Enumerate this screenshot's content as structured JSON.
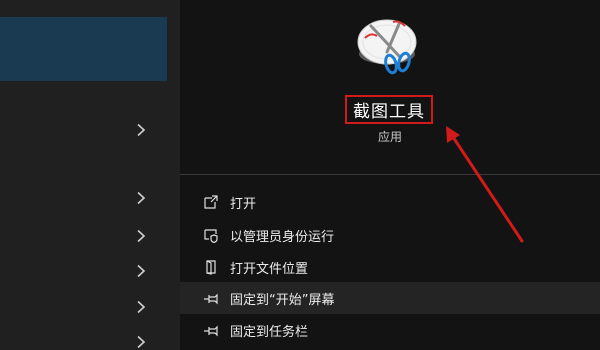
{
  "app": {
    "title": "截图工具",
    "subtitle": "应用",
    "icon": "snipping-tool-icon"
  },
  "left_panel": {
    "selected_color": "#1a3a52",
    "chevron_icon": "chevron-right-icon"
  },
  "context_menu": {
    "items": [
      {
        "label": "打开",
        "icon": "open-icon"
      },
      {
        "label": "以管理员身份运行",
        "icon": "run-as-admin-icon"
      },
      {
        "label": "打开文件位置",
        "icon": "file-location-icon"
      },
      {
        "label": "固定到“开始”屏幕",
        "icon": "pin-icon"
      },
      {
        "label": "固定到任务栏",
        "icon": "pin-icon"
      }
    ]
  },
  "colors": {
    "annotation": "#d11a1a",
    "menu_background": "#131313",
    "sidebar_background": "#202020"
  }
}
